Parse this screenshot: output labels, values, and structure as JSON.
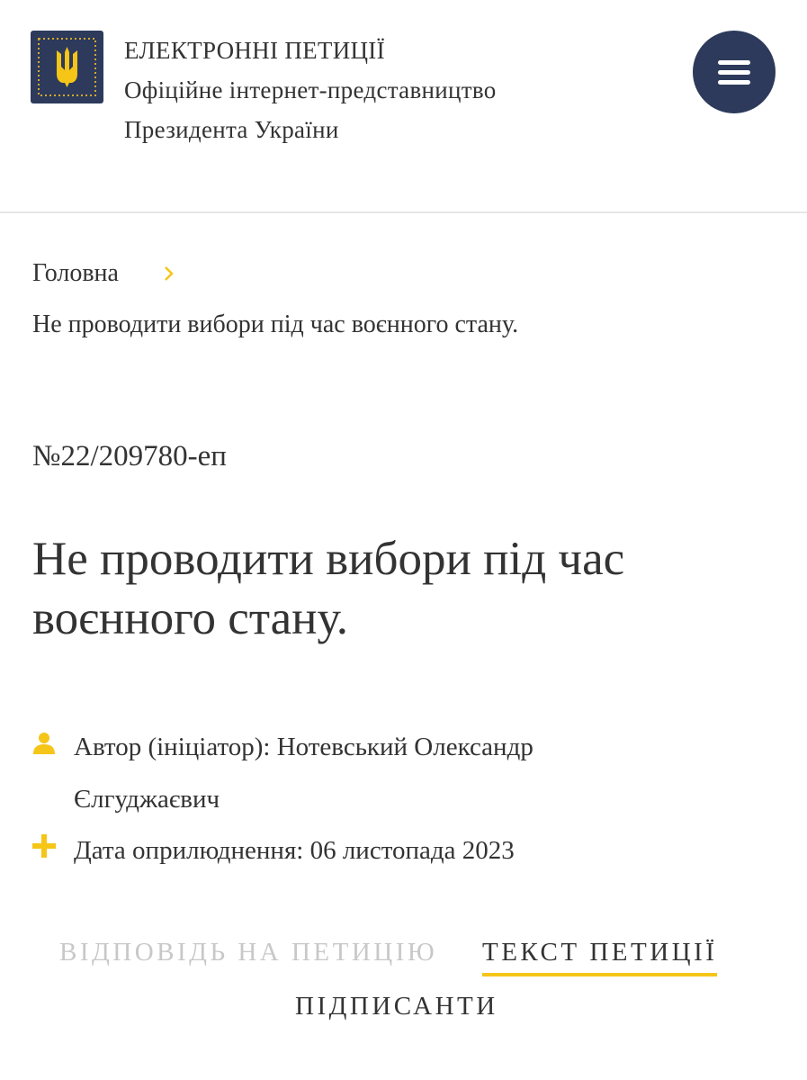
{
  "header": {
    "title_line1": "ЕЛЕКТРОННІ ПЕТИЦІЇ",
    "title_line2": "Офіційне інтернет-представництво",
    "title_line3": "Президента України",
    "logo_icon": "trident-coat-of-arms-icon",
    "menu_icon": "hamburger-menu-icon"
  },
  "breadcrumb": {
    "home": "Головна",
    "current": "Не проводити вибори під час воєнного стану."
  },
  "petition": {
    "number": "№22/209780-еп",
    "title": "Не проводити вибори під час воєнного стану.",
    "author_label": "Автор (ініціатор): Нотевський Олександр",
    "author_line2": "Єлгуджаєвич",
    "date_label": "Дата оприлюднення: 06 листопада 2023"
  },
  "tabs": {
    "response": "ВІДПОВІДЬ НА ПЕТИЦІЮ",
    "text": "ТЕКСТ ПЕТИЦІЇ",
    "signers": "ПІДПИСАНТИ"
  },
  "colors": {
    "brand_navy": "#2d3a5c",
    "accent_yellow": "#f5c518",
    "text": "#333333",
    "muted": "#c8c8c8"
  }
}
